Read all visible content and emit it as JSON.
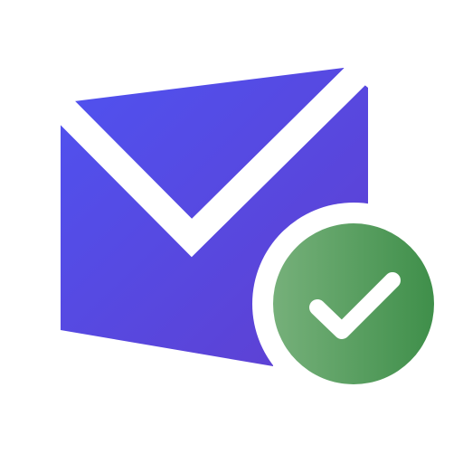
{
  "icon": {
    "name": "mail-verified-icon",
    "parts": [
      "envelope-icon",
      "checkmark-badge-icon"
    ]
  },
  "colors": {
    "background": "#ffffff",
    "envelope_gradient_start": "#4f52f0",
    "envelope_gradient_end": "#5f3fd0",
    "envelope_flap_stroke": "#ffffff",
    "badge_ring": "#ffffff",
    "badge_gradient_start": "#76b07a",
    "badge_gradient_end": "#3f8f4a",
    "check_mark": "#ffffff"
  }
}
